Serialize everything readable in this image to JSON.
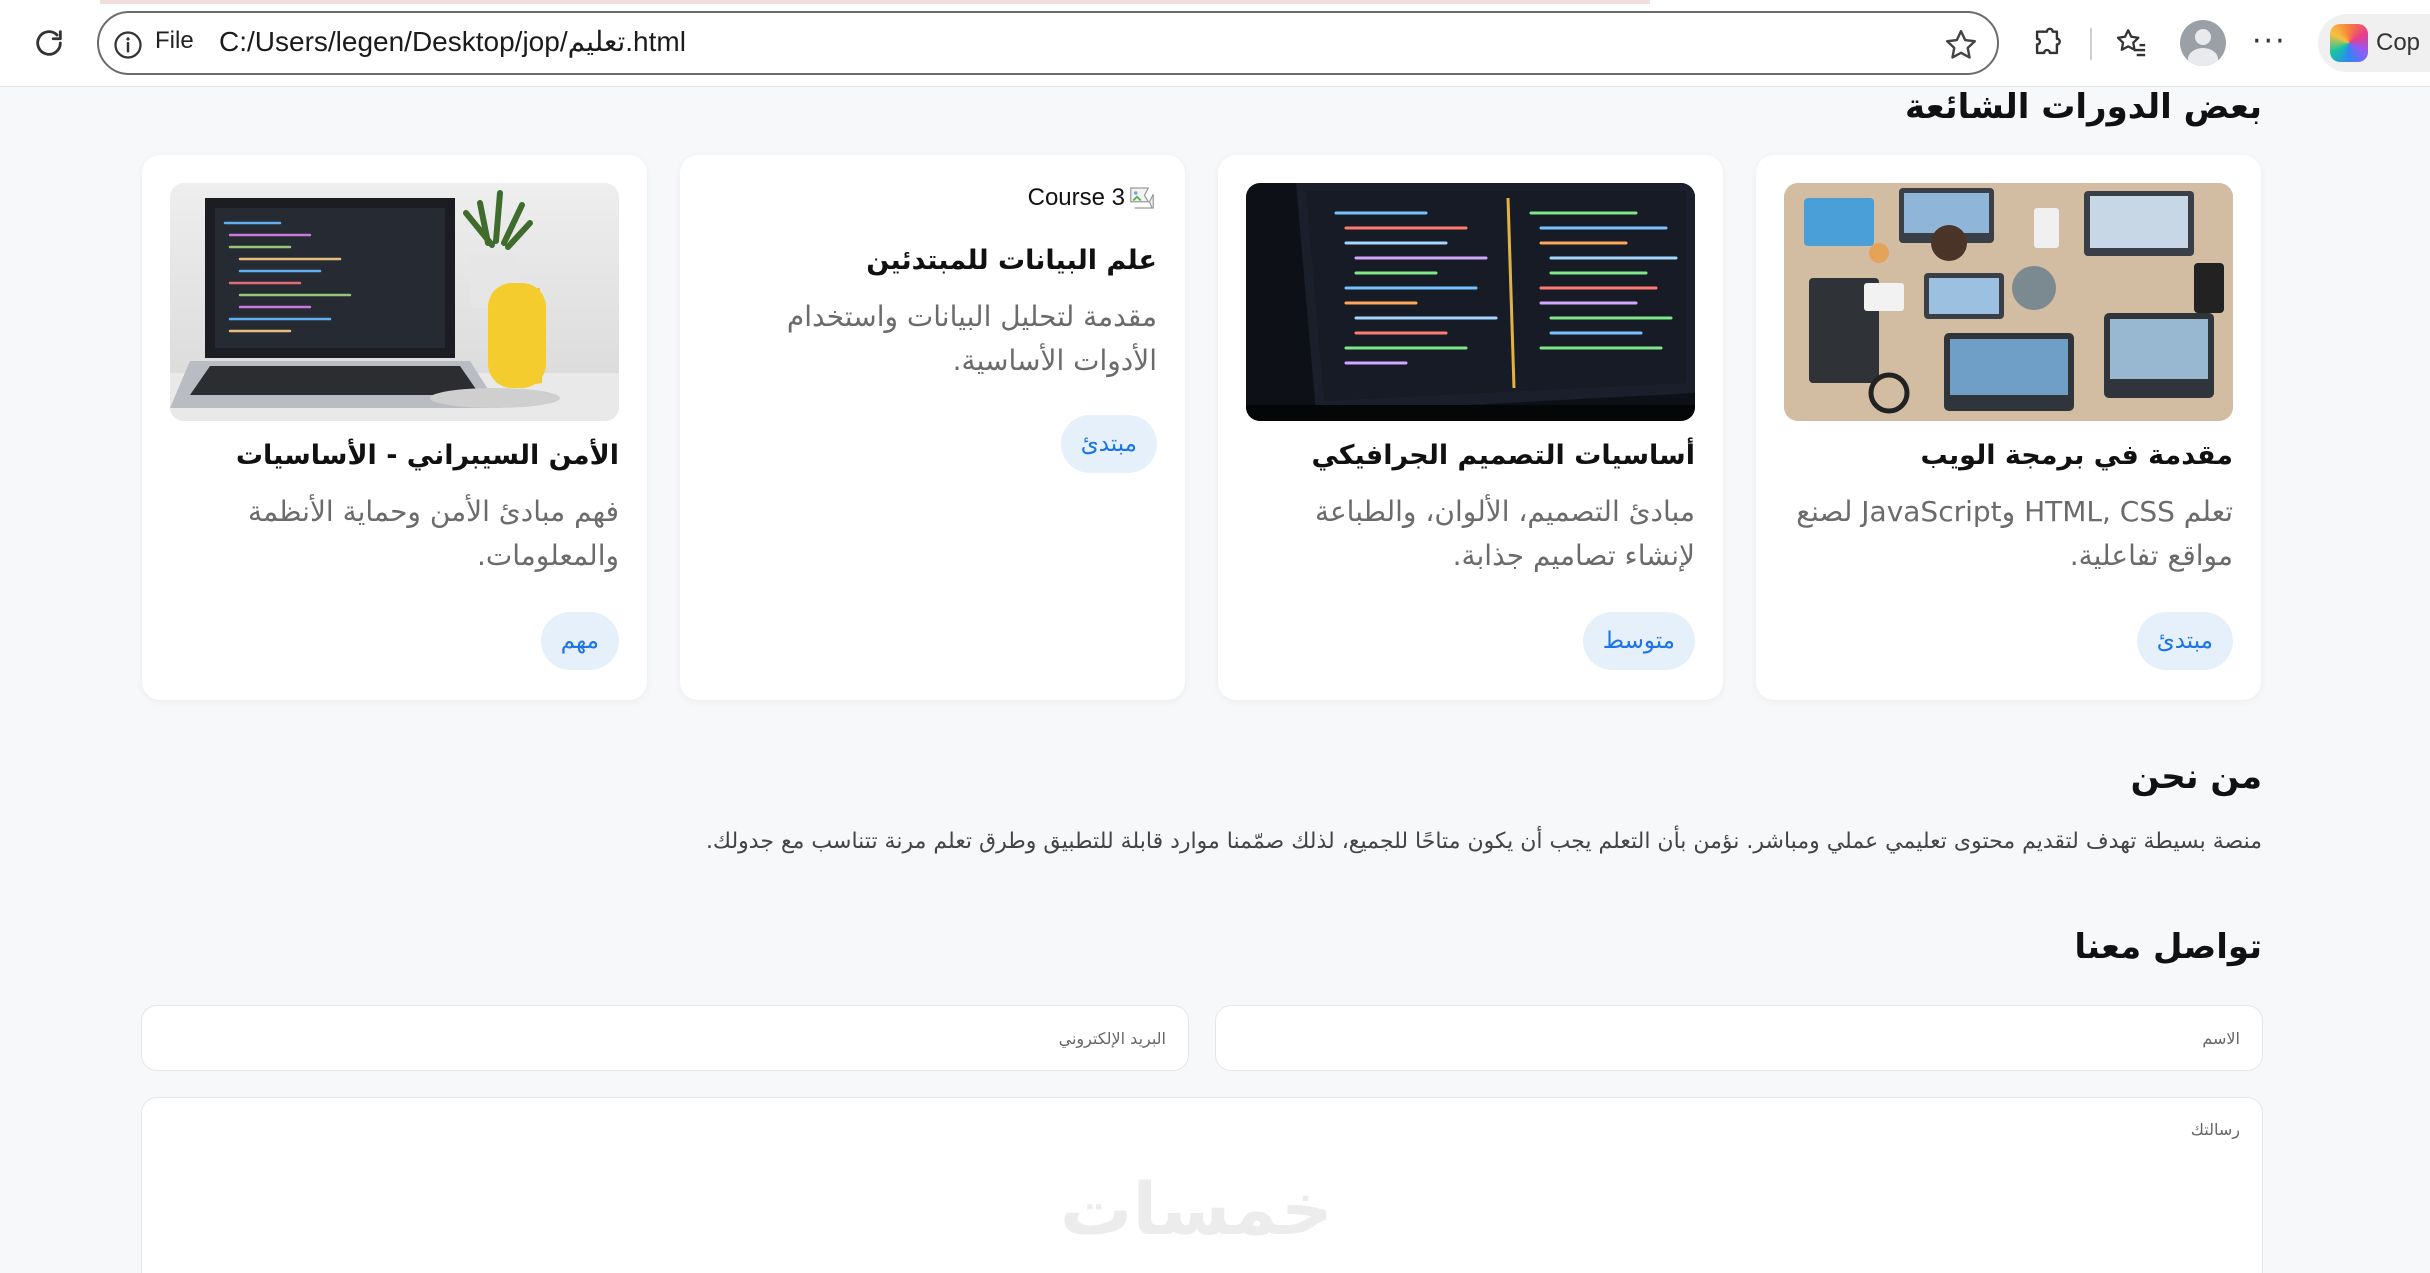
{
  "browser": {
    "file_label": "File",
    "url": "C:/Users/legen/Desktop/jop/تعليم.html",
    "copilot_label": "Cop",
    "icons": {
      "reload": "reload-icon",
      "info": "info-icon",
      "favorite": "star-icon",
      "extensions": "puzzle-icon",
      "favorites": "favorites-icon",
      "profile": "profile-icon",
      "more": "more-icon",
      "copilot": "copilot-icon"
    }
  },
  "courses": {
    "title": "بعض الدورات الشائعة",
    "items": [
      {
        "title": "مقدمة في برمجة الويب",
        "desc": "تعلم HTML, CSS وJavaScript لصنع مواقع تفاعلية.",
        "level": "مبتدئ"
      },
      {
        "title": "أساسيات التصميم الجرافيكي",
        "desc": "مبادئ التصميم، الألوان، والطباعة لإنشاء تصاميم جذابة.",
        "level": "متوسط"
      },
      {
        "img_alt": "Course 3",
        "title": "علم البيانات للمبتدئين",
        "desc": "مقدمة لتحليل البيانات واستخدام الأدوات الأساسية.",
        "level": "مبتدئ"
      },
      {
        "title": "الأمن السيبراني - الأساسيات",
        "desc": "فهم مبادئ الأمن وحماية الأنظمة والمعلومات.",
        "level": "مهم"
      }
    ]
  },
  "about": {
    "title": "من نحن",
    "text": "منصة بسيطة تهدف لتقديم محتوى تعليمي عملي ومباشر. نؤمن بأن التعلم يجب أن يكون متاحًا للجميع، لذلك صمّمنا موارد قابلة للتطبيق وطرق تعلم مرنة تتناسب مع جدولك."
  },
  "contact": {
    "title": "تواصل معنا",
    "name_placeholder": "الاسم",
    "email_placeholder": "البريد الإلكتروني",
    "message_placeholder": "رسالتك"
  },
  "watermark": "خمسات"
}
